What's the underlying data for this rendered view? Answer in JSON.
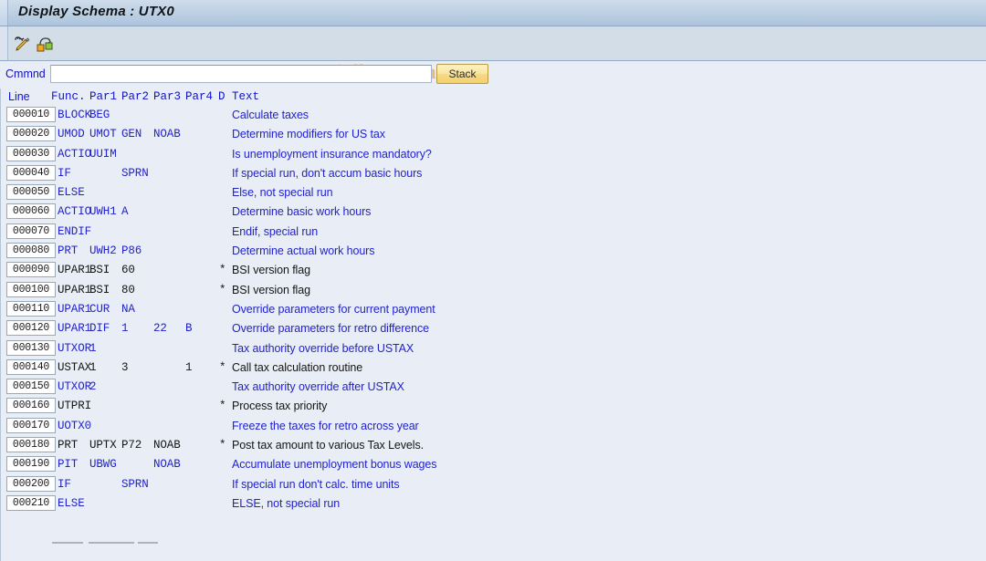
{
  "window": {
    "title": "Display Schema : UTX0"
  },
  "toolbar": {
    "icons": [
      {
        "name": "edit-pencil-icon",
        "title": "Display <-> Change"
      },
      {
        "name": "hierarchy-structure-icon",
        "title": "Structure"
      }
    ],
    "watermark": "© www.tutorialkart.com"
  },
  "command": {
    "label": "Cmmnd",
    "value": "",
    "placeholder": "",
    "stack_label": "Stack"
  },
  "grid": {
    "columns": [
      "Line",
      "Func.",
      "Par1",
      "Par2",
      "Par3",
      "Par4",
      "D",
      "Text"
    ],
    "rows": [
      {
        "line": "000010",
        "func": "BLOCK",
        "par1": "BEG",
        "par2": "",
        "par3": "",
        "par4": "",
        "d": "",
        "text": "Calculate taxes"
      },
      {
        "line": "000020",
        "func": "UMOD",
        "par1": "UMOT",
        "par2": "GEN",
        "par3": "NOAB",
        "par4": "",
        "d": "",
        "text": "Determine modifiers for US tax"
      },
      {
        "line": "000030",
        "func": "ACTIO",
        "par1": "UUIM",
        "par2": "",
        "par3": "",
        "par4": "",
        "d": "",
        "text": "Is unemployment insurance mandatory?"
      },
      {
        "line": "000040",
        "func": "IF",
        "par1": "",
        "par2": "SPRN",
        "par3": "",
        "par4": "",
        "d": "",
        "text": "If special run, don't accum basic hours"
      },
      {
        "line": "000050",
        "func": "ELSE",
        "par1": "",
        "par2": "",
        "par3": "",
        "par4": "",
        "d": "",
        "text": "Else, not special run"
      },
      {
        "line": "000060",
        "func": "ACTIO",
        "par1": "UWH1",
        "par2": "A",
        "par3": "",
        "par4": "",
        "d": "",
        "text": "Determine basic work hours"
      },
      {
        "line": "000070",
        "func": "ENDIF",
        "par1": "",
        "par2": "",
        "par3": "",
        "par4": "",
        "d": "",
        "text": "Endif, special run"
      },
      {
        "line": "000080",
        "func": "PRT",
        "par1": "UWH2",
        "par2": "P86",
        "par3": "",
        "par4": "",
        "d": "",
        "text": "Determine actual work hours"
      },
      {
        "line": "000090",
        "func": "UPAR1",
        "par1": "BSI",
        "par2": "60",
        "par3": "",
        "par4": "",
        "d": "*",
        "text": "BSI version flag"
      },
      {
        "line": "000100",
        "func": "UPAR1",
        "par1": "BSI",
        "par2": "80",
        "par3": "",
        "par4": "",
        "d": "*",
        "text": "BSI version flag"
      },
      {
        "line": "000110",
        "func": "UPAR1",
        "par1": "CUR",
        "par2": "NA",
        "par3": "",
        "par4": "",
        "d": "",
        "text": "Override parameters for current payment"
      },
      {
        "line": "000120",
        "func": "UPAR1",
        "par1": "DIF",
        "par2": "1",
        "par3": "22",
        "par4": "B",
        "d": "",
        "text": "Override parameters for retro difference"
      },
      {
        "line": "000130",
        "func": "UTXOR",
        "par1": "1",
        "par2": "",
        "par3": "",
        "par4": "",
        "d": "",
        "text": "Tax authority override before USTAX"
      },
      {
        "line": "000140",
        "func": "USTAX",
        "par1": "1",
        "par2": "3",
        "par3": "",
        "par4": "1",
        "d": "*",
        "text": "Call tax calculation routine"
      },
      {
        "line": "000150",
        "func": "UTXOR",
        "par1": "2",
        "par2": "",
        "par3": "",
        "par4": "",
        "d": "",
        "text": "Tax authority override after USTAX"
      },
      {
        "line": "000160",
        "func": "UTPRI",
        "par1": "",
        "par2": "",
        "par3": "",
        "par4": "",
        "d": "*",
        "text": "Process tax priority"
      },
      {
        "line": "000170",
        "func": "UOTX0",
        "par1": "",
        "par2": "",
        "par3": "",
        "par4": "",
        "d": "",
        "text": "Freeze the taxes for retro across year"
      },
      {
        "line": "000180",
        "func": "PRT",
        "par1": "UPTX",
        "par2": "P72",
        "par3": "NOAB",
        "par4": "",
        "d": "*",
        "text": "Post tax amount to various Tax Levels."
      },
      {
        "line": "000190",
        "func": "PIT",
        "par1": "UBWG",
        "par2": "",
        "par3": "NOAB",
        "par4": "",
        "d": "",
        "text": "Accumulate unemployment bonus wages"
      },
      {
        "line": "000200",
        "func": "IF",
        "par1": "",
        "par2": "SPRN",
        "par3": "",
        "par4": "",
        "d": "",
        "text": "If special run don't calc. time units"
      },
      {
        "line": "000210",
        "func": "ELSE",
        "par1": "",
        "par2": "",
        "par3": "",
        "par4": "",
        "d": "",
        "text": "ELSE, not special run"
      }
    ]
  },
  "colors": {
    "title_bar": "#bccfe3",
    "toolbar": "#d2dde8",
    "page_background": "#e9eef6",
    "link_blue": "#2222cc",
    "marked_black": "#151515",
    "stack_yellow": "#f7da86",
    "watermark_tan": "#e9b784"
  }
}
